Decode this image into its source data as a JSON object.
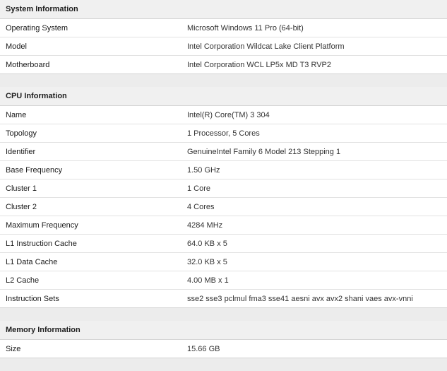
{
  "system": {
    "title": "System Information",
    "rows": [
      {
        "label": "Operating System",
        "value": "Microsoft Windows 11 Pro (64-bit)"
      },
      {
        "label": "Model",
        "value": "Intel Corporation Wildcat Lake Client Platform"
      },
      {
        "label": "Motherboard",
        "value": "Intel Corporation WCL LP5x MD T3 RVP2"
      }
    ]
  },
  "cpu": {
    "title": "CPU Information",
    "rows": [
      {
        "label": "Name",
        "value": "Intel(R) Core(TM) 3 304"
      },
      {
        "label": "Topology",
        "value": "1 Processor, 5 Cores"
      },
      {
        "label": "Identifier",
        "value": "GenuineIntel Family 6 Model 213 Stepping 1"
      },
      {
        "label": "Base Frequency",
        "value": "1.50 GHz"
      },
      {
        "label": "Cluster 1",
        "value": "1 Core"
      },
      {
        "label": "Cluster 2",
        "value": "4 Cores"
      },
      {
        "label": "Maximum Frequency",
        "value": "4284 MHz"
      },
      {
        "label": "L1 Instruction Cache",
        "value": "64.0 KB x 5"
      },
      {
        "label": "L1 Data Cache",
        "value": "32.0 KB x 5"
      },
      {
        "label": "L2 Cache",
        "value": "4.00 MB x 1"
      },
      {
        "label": "Instruction Sets",
        "value": "sse2 sse3 pclmul fma3 sse41 aesni avx avx2 shani vaes avx-vnni"
      }
    ]
  },
  "memory": {
    "title": "Memory Information",
    "rows": [
      {
        "label": "Size",
        "value": "15.66 GB"
      }
    ]
  }
}
